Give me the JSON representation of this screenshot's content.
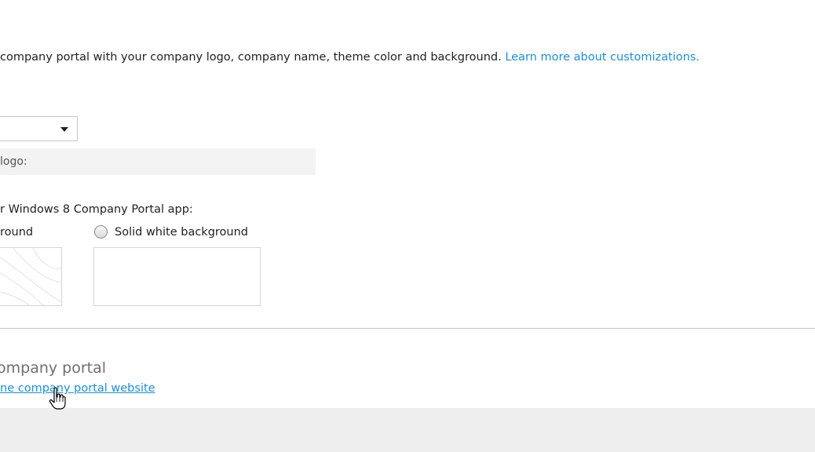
{
  "intro": {
    "text": "company portal with your company logo, company name, theme color and background. ",
    "link": "Learn more about customizations."
  },
  "logo": {
    "label": "logo:"
  },
  "background": {
    "label": "r Windows 8 Company Portal app:",
    "option_left_label": "round",
    "option_right_label": "Solid white background"
  },
  "company_portal": {
    "title": "ompany portal",
    "link": "ne company portal website"
  },
  "icons": {
    "dropdown": "chevron-down-icon",
    "cursor": "hand-pointer-icon"
  },
  "colors": {
    "link": "#1a8fd9",
    "footer": "#eeeeef"
  }
}
